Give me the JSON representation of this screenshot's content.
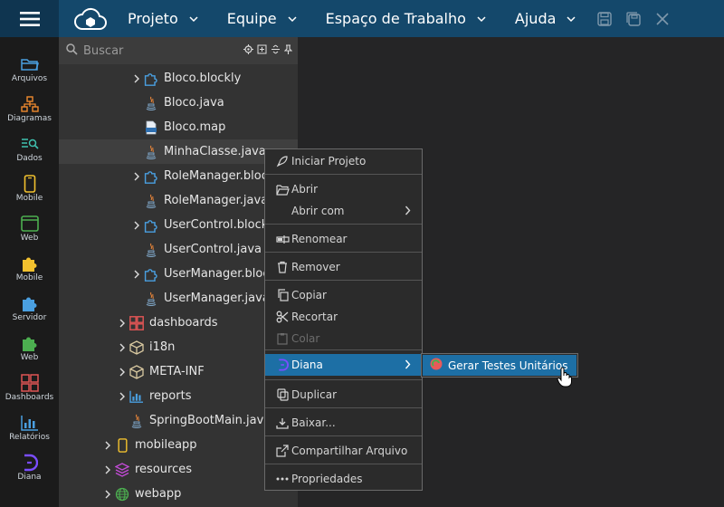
{
  "topbar": {
    "menus": [
      {
        "label": "Projeto"
      },
      {
        "label": "Equipe"
      },
      {
        "label": "Espaço de Trabalho"
      },
      {
        "label": "Ajuda"
      }
    ],
    "icons": [
      "save-icon",
      "save-all-icon",
      "close-icon"
    ],
    "accent": "#14486b"
  },
  "rail": {
    "items": [
      {
        "label": "Arquivos",
        "icon": "folder-icon",
        "color": "#4a9fe0"
      },
      {
        "label": "Diagramas",
        "icon": "diagram-icon",
        "color": "#f08a2e"
      },
      {
        "label": "Dados",
        "icon": "data-search-icon",
        "color": "#3fc1b0"
      },
      {
        "label": "Mobile",
        "icon": "mobile-icon",
        "color": "#f2c12e"
      },
      {
        "label": "Web",
        "icon": "web-window-icon",
        "color": "#4caf50"
      },
      {
        "label": "Mobile",
        "icon": "puzzle-mobile-icon",
        "color": "#f2c12e"
      },
      {
        "label": "Servidor",
        "icon": "puzzle-server-icon",
        "color": "#4a9fe0"
      },
      {
        "label": "Web",
        "icon": "puzzle-web-icon",
        "color": "#4caf50"
      },
      {
        "label": "Dashboards",
        "icon": "dashboard-icon",
        "color": "#e05555"
      },
      {
        "label": "Relatórios",
        "icon": "report-icon",
        "color": "#4a9fe0"
      },
      {
        "label": "Diana",
        "icon": "diana-icon",
        "color": "#7a4dff"
      }
    ]
  },
  "search": {
    "placeholder": "Buscar"
  },
  "tree": [
    {
      "label": "Bloco.blockly",
      "icon": "blockly-icon",
      "arrow": true,
      "indent": 2
    },
    {
      "label": "Bloco.java",
      "icon": "java-icon",
      "arrow": false,
      "indent": 2
    },
    {
      "label": "Bloco.map",
      "icon": "json-icon",
      "arrow": false,
      "indent": 2
    },
    {
      "label": "MinhaClasse.java",
      "icon": "java-icon",
      "arrow": false,
      "indent": 2,
      "selected": true
    },
    {
      "label": "RoleManager.blockly",
      "icon": "blockly-icon",
      "arrow": true,
      "indent": 2
    },
    {
      "label": "RoleManager.java",
      "icon": "java-icon",
      "arrow": false,
      "indent": 2
    },
    {
      "label": "UserControl.blockly",
      "icon": "blockly-icon",
      "arrow": true,
      "indent": 2
    },
    {
      "label": "UserControl.java",
      "icon": "java-icon",
      "arrow": false,
      "indent": 2
    },
    {
      "label": "UserManager.blockly",
      "icon": "blockly-icon",
      "arrow": true,
      "indent": 2
    },
    {
      "label": "UserManager.java",
      "icon": "java-icon",
      "arrow": false,
      "indent": 2
    },
    {
      "label": "dashboards",
      "icon": "dashboard-folder-icon",
      "arrow": true,
      "indent": 1
    },
    {
      "label": "i18n",
      "icon": "cube-icon",
      "arrow": true,
      "indent": 1
    },
    {
      "label": "META-INF",
      "icon": "cube-icon",
      "arrow": true,
      "indent": 1
    },
    {
      "label": "reports",
      "icon": "report-folder-icon",
      "arrow": true,
      "indent": 1
    },
    {
      "label": "SpringBootMain.java",
      "icon": "java-icon",
      "arrow": false,
      "indent": 1
    },
    {
      "label": "mobileapp",
      "icon": "mobileapp-folder-icon",
      "arrow": true,
      "indent": 0
    },
    {
      "label": "resources",
      "icon": "layers-icon",
      "arrow": true,
      "indent": 0
    },
    {
      "label": "webapp",
      "icon": "globe-icon",
      "arrow": true,
      "indent": 0
    }
  ],
  "context_menu": {
    "items": [
      {
        "label": "Iniciar Projeto",
        "icon": "rocket-icon"
      },
      {
        "label": "Abrir",
        "icon": "folder-open-icon"
      },
      {
        "label": "Abrir com",
        "icon": "",
        "submenu": true
      },
      {
        "label": "Renomear",
        "icon": "rename-icon"
      },
      {
        "label": "Remover",
        "icon": "trash-icon"
      },
      {
        "label": "Copiar",
        "icon": "copy-icon"
      },
      {
        "label": "Recortar",
        "icon": "scissors-icon"
      },
      {
        "label": "Colar",
        "icon": "paste-icon",
        "disabled": true
      },
      {
        "label": "Diana",
        "icon": "diana-icon",
        "submenu": true,
        "active": true
      },
      {
        "label": "Duplicar",
        "icon": "duplicate-icon"
      },
      {
        "label": "Baixar...",
        "icon": "download-icon"
      },
      {
        "label": "Compartilhar Arquivo",
        "icon": "share-icon"
      },
      {
        "label": "Propriedades",
        "icon": "more-icon"
      }
    ]
  },
  "submenu": {
    "label": "Gerar Testes Unitários",
    "icon": "test-generate-icon"
  }
}
